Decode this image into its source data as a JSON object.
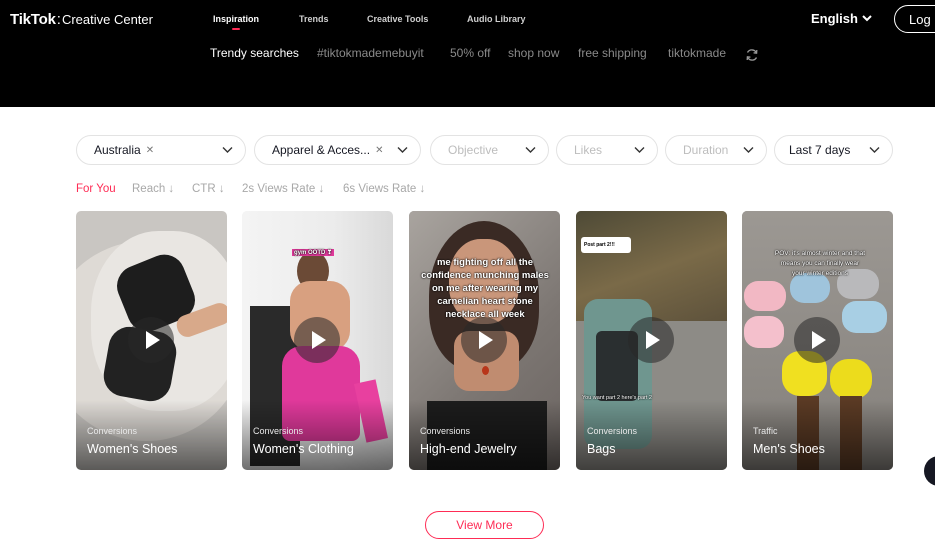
{
  "header": {
    "logo_brand": "TikTok",
    "logo_sep": ":",
    "logo_sub": "Creative Center",
    "nav": [
      "Inspiration",
      "Trends",
      "Creative Tools",
      "Audio Library"
    ],
    "language": "English",
    "login": "Log"
  },
  "trending": {
    "label": "Trendy searches",
    "keywords": [
      "#tiktokmademebuyit",
      "50% off",
      "shop now",
      "free shipping",
      "tiktokmade"
    ]
  },
  "filters": {
    "region": "Australia",
    "industry": "Apparel & Acces...",
    "objective": "Objective",
    "likes": "Likes",
    "duration": "Duration",
    "period": "Last 7 days"
  },
  "sort_tabs": [
    "For You",
    "Reach ↓",
    "CTR ↓",
    "2s Views Rate ↓",
    "6s Views Rate ↓"
  ],
  "cards": [
    {
      "objective": "Conversions",
      "industry": "Women's Shoes"
    },
    {
      "objective": "Conversions",
      "industry": "Women's Clothing",
      "overlay": "gym OOTD ❣"
    },
    {
      "objective": "Conversions",
      "industry": "High-end Jewelry",
      "overlay": "me fighting off all the confidence munching males on me after wearing my carnelian heart stone necklace all week"
    },
    {
      "objective": "Conversions",
      "industry": "Bags",
      "overlay_top": "Post part 2!!!",
      "overlay_bottom": "You want part 2 here's part 2"
    },
    {
      "objective": "Traffic",
      "industry": "Men's Shoes",
      "overlay": "POV: it's almost winter and that means you can finally wear your winter editions"
    }
  ],
  "view_more": "View More",
  "colors": {
    "accent": "#fe2c55",
    "header_bg": "#000000"
  }
}
